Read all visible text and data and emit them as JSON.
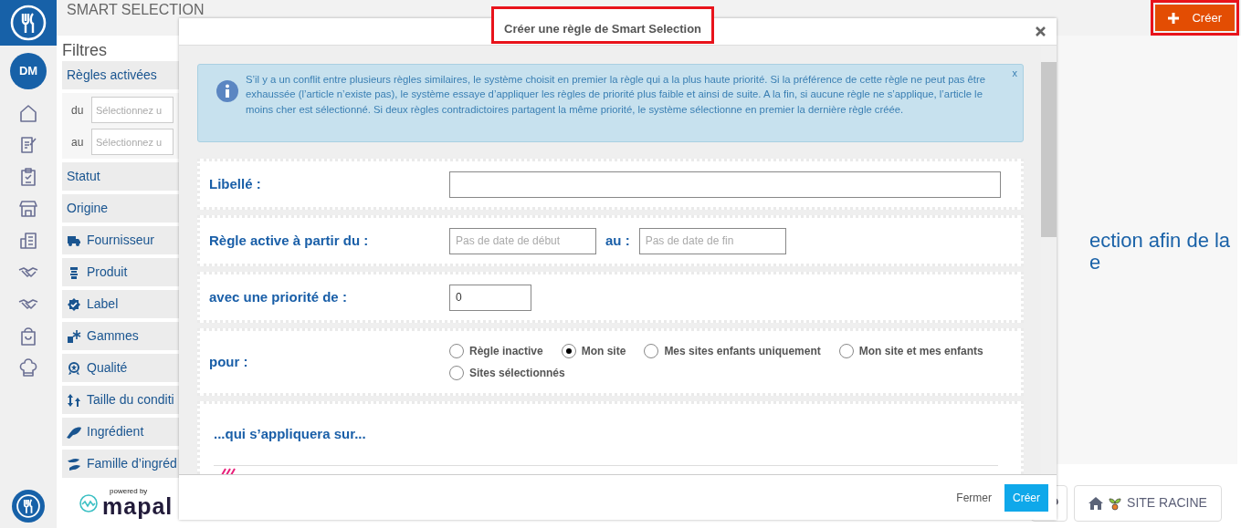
{
  "sidebar": {
    "avatar": "DM"
  },
  "page": {
    "title": "SMART SELECTION",
    "create_button": "Créer",
    "filters_title": "Filtres",
    "filters": [
      {
        "label": "Règles activées",
        "kind": "dates",
        "fields": [
          {
            "label": "du",
            "placeholder": "Sélectionnez u"
          },
          {
            "label": "au",
            "placeholder": "Sélectionnez u"
          }
        ]
      },
      {
        "label": "Statut",
        "kind": "plain"
      },
      {
        "label": "Origine",
        "kind": "plain"
      },
      {
        "label": "Fournisseur",
        "kind": "icon"
      },
      {
        "label": "Produit",
        "kind": "icon"
      },
      {
        "label": "Label",
        "kind": "icon"
      },
      {
        "label": "Gammes",
        "kind": "icon"
      },
      {
        "label": "Qualité",
        "kind": "icon"
      },
      {
        "label": "Taille du conditi",
        "kind": "icon"
      },
      {
        "label": "Ingrédient",
        "kind": "icon"
      },
      {
        "label": "Famille d’ingréd",
        "kind": "icon"
      }
    ],
    "message": [
      "ection afin de la",
      "e"
    ],
    "site_button": "SITE RACINE",
    "powered_by": "powered by",
    "brand": "mapal"
  },
  "modal": {
    "title": "Créer une règle de Smart Selection",
    "info": {
      "text": "S’il y a un conflit entre plusieurs règles similaires, le système choisit en premier la règle qui a la plus haute priorité. Si la préférence de cette règle ne peut pas être exhaussée (l’article n’existe pas), le système essaye d’appliquer les règles de priorité plus faible et ainsi de suite. A la fin, si aucune règle ne s’applique, l’article le moins cher est sélectionné. Si deux règles contradictoires partagent la même priorité, le système sélectionne en premier la dernière règle créée.",
      "close": "x"
    },
    "fields": [
      {
        "kind": "text",
        "label": "Libellé :"
      },
      {
        "kind": "daterange",
        "label": "Règle active à partir du :",
        "from_placeholder": "Pas de date de début",
        "to_label": "au :",
        "to_placeholder": "Pas de date de fin"
      },
      {
        "kind": "number",
        "label": "avec une priorité de :",
        "value": "0"
      },
      {
        "kind": "radio",
        "label": "pour :",
        "options": [
          {
            "label": "Règle inactive",
            "selected": false
          },
          {
            "label": "Mon site",
            "selected": true
          },
          {
            "label": "Mes sites enfants uniquement",
            "selected": false
          },
          {
            "label": "Mon site et mes enfants",
            "selected": false
          },
          {
            "label": "Sites sélectionnés",
            "selected": false
          }
        ]
      },
      {
        "kind": "section",
        "label": "...qui s’appliquera sur..."
      }
    ],
    "footer": {
      "close": "Fermer",
      "submit": "Créer"
    }
  }
}
